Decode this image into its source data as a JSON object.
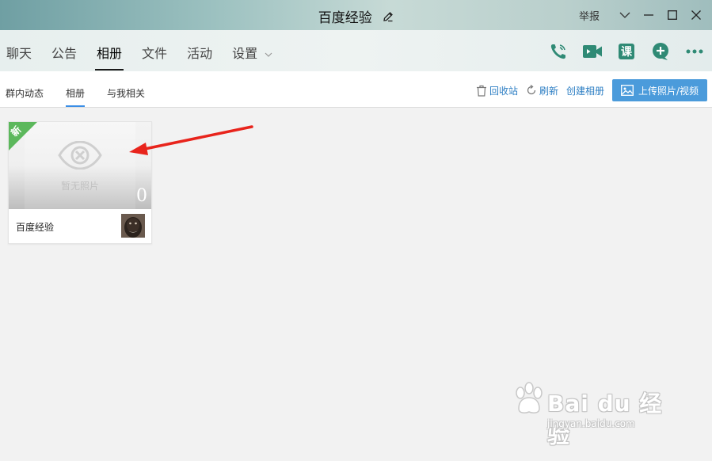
{
  "window": {
    "title": "百度经验",
    "report_label": "举报",
    "controls": [
      "chevron-down-icon",
      "minimize-icon",
      "maximize-icon",
      "close-icon"
    ]
  },
  "tabs": [
    {
      "label": "聊天"
    },
    {
      "label": "公告"
    },
    {
      "label": "相册",
      "active": true
    },
    {
      "label": "文件"
    },
    {
      "label": "活动"
    },
    {
      "label": "设置",
      "has_dropdown": true
    }
  ],
  "tab_icons": [
    "phone-call-icon",
    "video-call-icon",
    "class-icon",
    "add-app-icon",
    "more-icon"
  ],
  "class_icon_text": "课",
  "subtabs": [
    {
      "label": "群内动态"
    },
    {
      "label": "相册",
      "active": true
    },
    {
      "label": "与我相关"
    }
  ],
  "actions": {
    "recycle_bin": "回收站",
    "refresh": "刷新",
    "create_album": "创建相册",
    "upload": "上传照片/视频"
  },
  "album": {
    "new_badge": "新",
    "no_photo_text": "暂无照片",
    "count": "0",
    "name": "百度经验"
  },
  "colors": {
    "accent_blue": "#4b9bdb",
    "link_blue": "#2e7fc4",
    "icon_green": "#2f8a75",
    "badge_green": "#5cb85c",
    "arrow_red": "#e8241c"
  },
  "watermark": {
    "brand": "Bai du 经验",
    "url": "jingyan.baidu.com"
  }
}
